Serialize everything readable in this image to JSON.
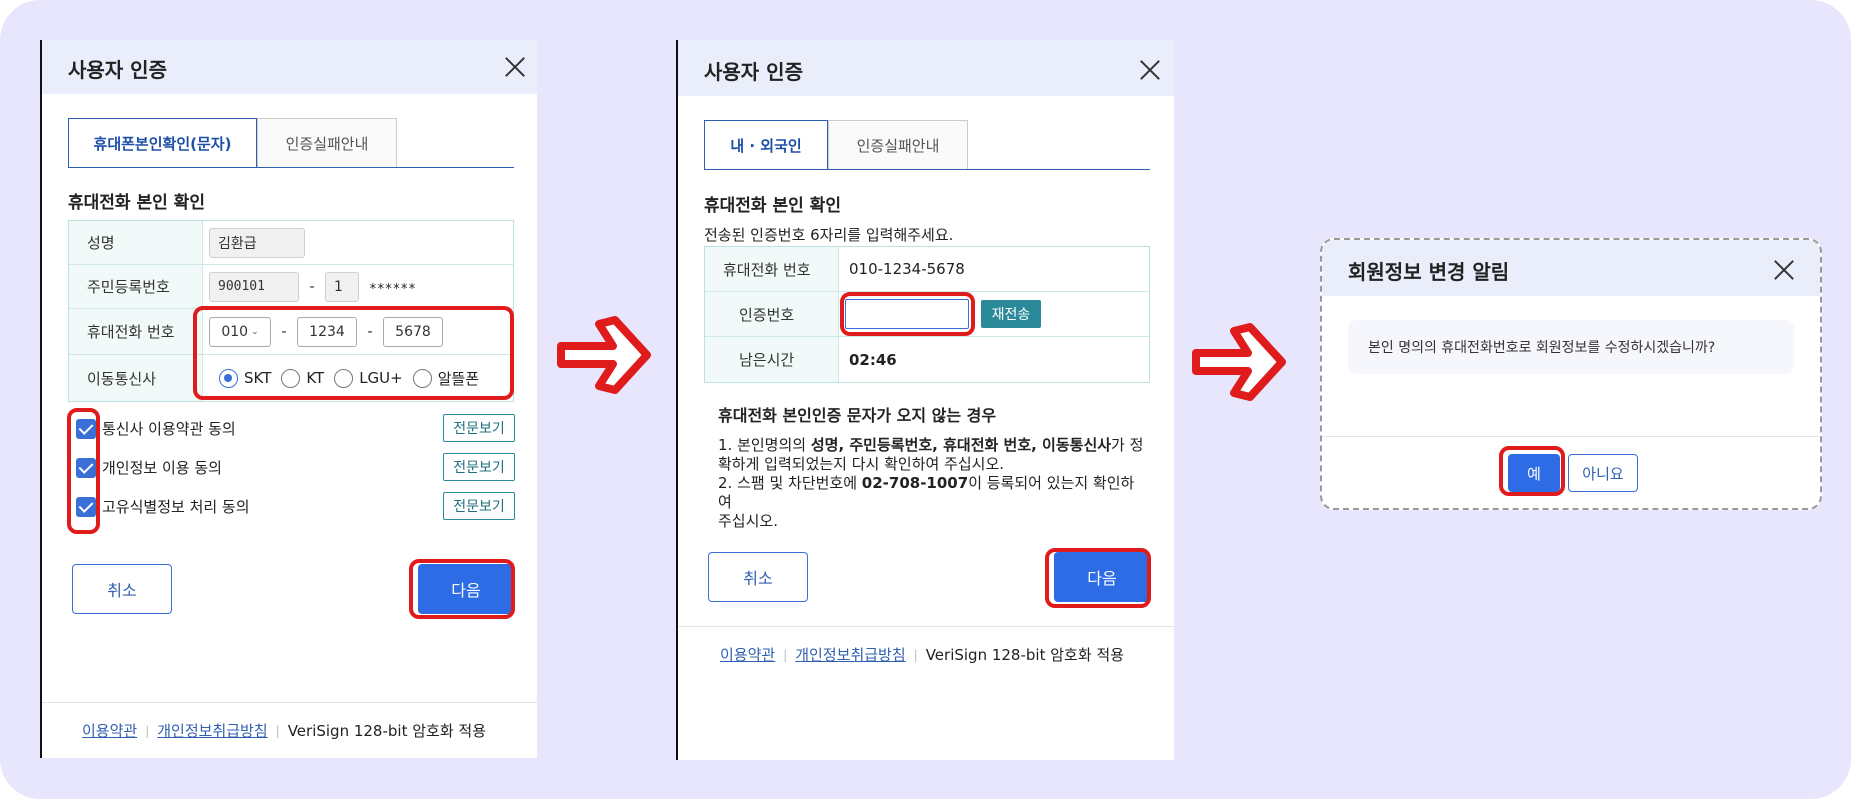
{
  "step1": {
    "title": "사용자 인증",
    "tabs": [
      "휴대폰본인확인(문자)",
      "인증실패안내"
    ],
    "section_title": "휴대전화 본인 확인",
    "labels": {
      "name": "성명",
      "rrn": "주민등록번호",
      "phone": "휴대전화 번호",
      "carrier": "이동통신사"
    },
    "values": {
      "name": "김환급",
      "rrn_front": "900101",
      "rrn_back_first": "1",
      "rrn_mask": "******",
      "phone_prefix": "010",
      "phone_mid": "1234",
      "phone_last": "5678",
      "dash": "-"
    },
    "carriers": [
      "SKT",
      "KT",
      "LGU+",
      "알뜰폰"
    ],
    "selected_carrier": "SKT",
    "agreements": [
      "통신사 이용약관 동의",
      "개인정보 이용 동의",
      "고유식별정보 처리 동의"
    ],
    "view_label": "전문보기",
    "cancel": "취소",
    "next": "다음",
    "footer": {
      "terms": "이용약관",
      "privacy": "개인정보취급방침",
      "security": "VeriSign 128-bit 암호화 적용"
    }
  },
  "step2": {
    "title": "사용자 인증",
    "tabs": [
      "내 · 외국인",
      "인증실패안내"
    ],
    "section_title": "휴대전화 본인 확인",
    "instruction": "전송된 인증번호 6자리를 입력해주세요.",
    "labels": {
      "phone": "휴대전화 번호",
      "code": "인증번호",
      "remaining": "남은시간"
    },
    "phone_value": "010-1234-5678",
    "code_value": "",
    "resend": "재전송",
    "timer": "02:46",
    "notice_title": "휴대전화 본인인증 문자가 오지 않는 경우",
    "notice": {
      "l1_a": "1. 본인명의의 ",
      "l1_b": "성명, 주민등록번호, 휴대전화 번호, 이동통신사",
      "l1_c": "가 정",
      "l2": "확하게 입력되었는지 다시 확인하여 주십시오.",
      "l3_a": "2. 스팸 및 차단번호에 ",
      "l3_b": "02-708-1007",
      "l3_c": "이 등록되어 있는지 확인하여",
      "l4": "주십시오."
    },
    "cancel": "취소",
    "next": "다음",
    "footer": {
      "terms": "이용약관",
      "privacy": "개인정보취급방침",
      "security": "VeriSign 128-bit 암호화 적용"
    }
  },
  "step3": {
    "title": "회원정보 변경 알림",
    "message": "본인 명의의 휴대전화번호로 회원정보를 수정하시겠습니까?",
    "yes": "예",
    "no": "아니요"
  },
  "colors": {
    "background": "#e8e6fc",
    "highlight": "#e01b1b",
    "primary": "#2e6ce6",
    "header": "#e9eefa"
  }
}
